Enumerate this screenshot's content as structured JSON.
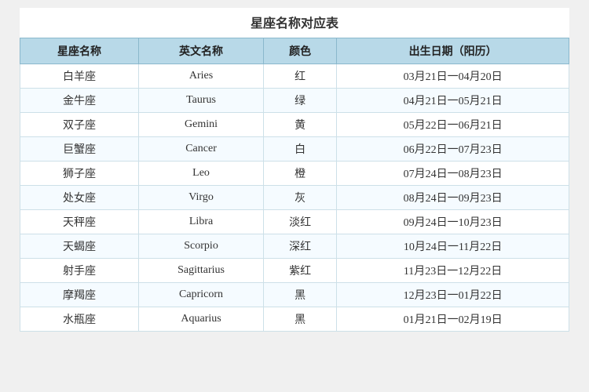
{
  "title": "星座名称对应表",
  "table": {
    "headers": [
      "星座名称",
      "英文名称",
      "颜色",
      "出生日期（阳历）"
    ],
    "rows": [
      {
        "chinese": "白羊座",
        "english": "Aries",
        "color": "红",
        "dates": "03月21日一04月20日"
      },
      {
        "chinese": "金牛座",
        "english": "Taurus",
        "color": "绿",
        "dates": "04月21日一05月21日"
      },
      {
        "chinese": "双子座",
        "english": "Gemini",
        "color": "黄",
        "dates": "05月22日一06月21日"
      },
      {
        "chinese": "巨蟹座",
        "english": "Cancer",
        "color": "白",
        "dates": "06月22日一07月23日"
      },
      {
        "chinese": "狮子座",
        "english": "Leo",
        "color": "橙",
        "dates": "07月24日一08月23日"
      },
      {
        "chinese": "处女座",
        "english": "Virgo",
        "color": "灰",
        "dates": "08月24日一09月23日"
      },
      {
        "chinese": "天秤座",
        "english": "Libra",
        "color": "淡红",
        "dates": "09月24日一10月23日"
      },
      {
        "chinese": "天蝎座",
        "english": "Scorpio",
        "color": "深红",
        "dates": "10月24日一11月22日"
      },
      {
        "chinese": "射手座",
        "english": "Sagittarius",
        "color": "紫红",
        "dates": "11月23日一12月22日"
      },
      {
        "chinese": "摩羯座",
        "english": "Capricorn",
        "color": "黑",
        "dates": "12月23日一01月22日"
      },
      {
        "chinese": "水瓶座",
        "english": "Aquarius",
        "color": "黑",
        "dates": "01月21日一02月19日"
      }
    ]
  }
}
